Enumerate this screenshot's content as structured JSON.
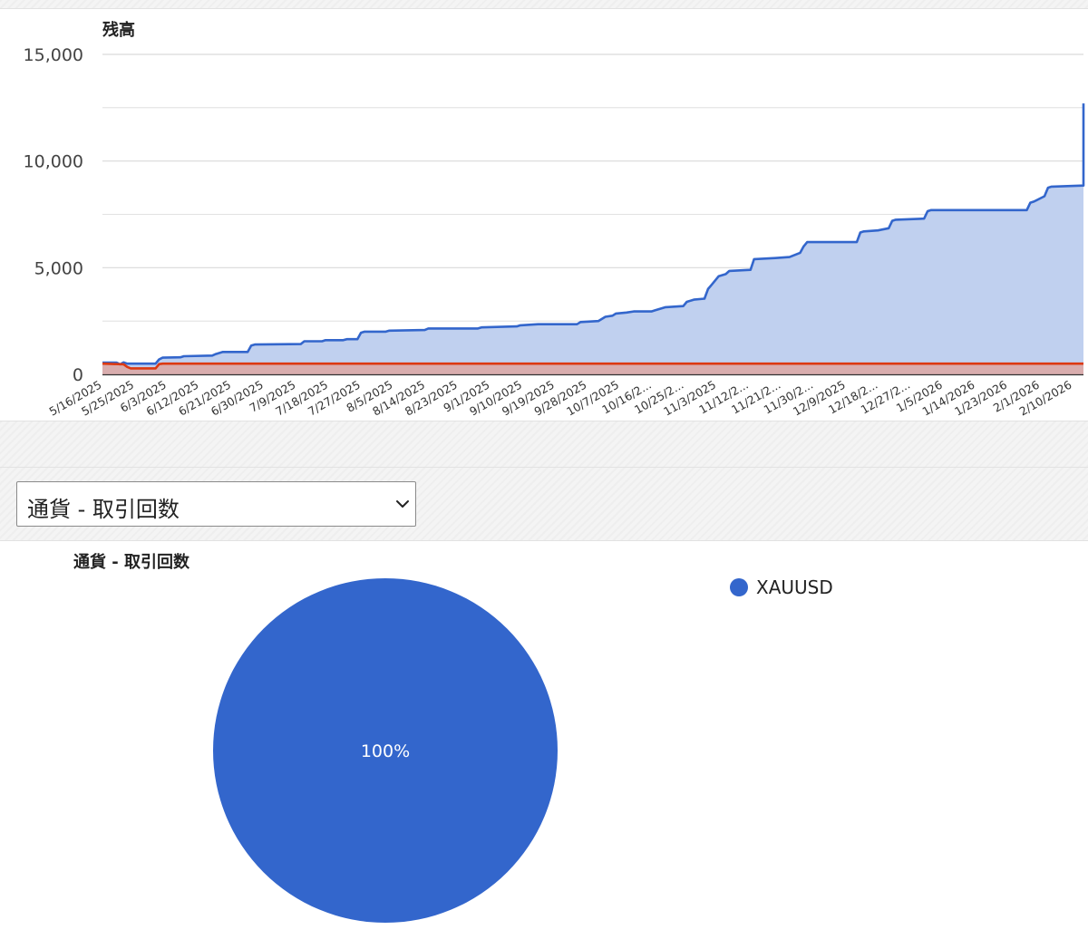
{
  "chart_data": [
    {
      "type": "area",
      "title": "残高",
      "xlabel": "",
      "ylabel": "",
      "ylim": [
        0,
        15000
      ],
      "y_ticks": [
        "0",
        "5,000",
        "10,000",
        "15,000"
      ],
      "y_tick_values": [
        0,
        5000,
        10000,
        15000
      ],
      "grid": true,
      "legend": "none",
      "x_tick_labels": [
        "5/16/2025",
        "5/25/2025",
        "6/3/2025",
        "6/12/2025",
        "6/21/2025",
        "6/30/2025",
        "7/9/2025",
        "7/18/2025",
        "7/27/2025",
        "8/5/2025",
        "8/14/2025",
        "8/23/2025",
        "9/1/2025",
        "9/10/2025",
        "9/19/2025",
        "9/28/2025",
        "10/7/2025",
        "10/16/2...",
        "10/25/2...",
        "11/3/2025",
        "11/12/2...",
        "11/21/2...",
        "11/30/2...",
        "12/9/2025",
        "12/18/2...",
        "12/27/2...",
        "1/5/2026",
        "1/14/2026",
        "1/23/2026",
        "2/1/2026",
        "2/10/2026"
      ],
      "x_range": [
        "2025-05-14",
        "2026-02-15"
      ],
      "series": [
        {
          "color": "#3366cc",
          "fill": "#c0d0ef",
          "points": [
            [
              "2025-05-14",
              550
            ],
            [
              "2025-05-18",
              550
            ],
            [
              "2025-05-19",
              470
            ],
            [
              "2025-05-20",
              560
            ],
            [
              "2025-05-21",
              500
            ],
            [
              "2025-05-29",
              500
            ],
            [
              "2025-05-30",
              700
            ],
            [
              "2025-05-31",
              780
            ],
            [
              "2025-06-05",
              800
            ],
            [
              "2025-06-06",
              850
            ],
            [
              "2025-06-14",
              880
            ],
            [
              "2025-06-15",
              950
            ],
            [
              "2025-06-17",
              1050
            ],
            [
              "2025-06-24",
              1050
            ],
            [
              "2025-06-25",
              1350
            ],
            [
              "2025-06-26",
              1400
            ],
            [
              "2025-07-09",
              1420
            ],
            [
              "2025-07-10",
              1550
            ],
            [
              "2025-07-15",
              1550
            ],
            [
              "2025-07-16",
              1600
            ],
            [
              "2025-07-21",
              1600
            ],
            [
              "2025-07-22",
              1650
            ],
            [
              "2025-07-25",
              1650
            ],
            [
              "2025-07-26",
              1950
            ],
            [
              "2025-07-27",
              2000
            ],
            [
              "2025-08-02",
              2000
            ],
            [
              "2025-08-03",
              2050
            ],
            [
              "2025-08-13",
              2080
            ],
            [
              "2025-08-14",
              2150
            ],
            [
              "2025-08-28",
              2150
            ],
            [
              "2025-08-29",
              2200
            ],
            [
              "2025-09-08",
              2250
            ],
            [
              "2025-09-09",
              2300
            ],
            [
              "2025-09-14",
              2350
            ],
            [
              "2025-09-25",
              2350
            ],
            [
              "2025-09-26",
              2450
            ],
            [
              "2025-10-01",
              2500
            ],
            [
              "2025-10-03",
              2700
            ],
            [
              "2025-10-05",
              2750
            ],
            [
              "2025-10-06",
              2850
            ],
            [
              "2025-10-09",
              2900
            ],
            [
              "2025-10-11",
              2950
            ],
            [
              "2025-10-16",
              2950
            ],
            [
              "2025-10-17",
              3000
            ],
            [
              "2025-10-20",
              3150
            ],
            [
              "2025-10-25",
              3200
            ],
            [
              "2025-10-26",
              3400
            ],
            [
              "2025-10-28",
              3500
            ],
            [
              "2025-10-31",
              3550
            ],
            [
              "2025-11-01",
              4000
            ],
            [
              "2025-11-02",
              4200
            ],
            [
              "2025-11-04",
              4600
            ],
            [
              "2025-11-06",
              4700
            ],
            [
              "2025-11-07",
              4850
            ],
            [
              "2025-11-13",
              4900
            ],
            [
              "2025-11-14",
              5400
            ],
            [
              "2025-11-20",
              5450
            ],
            [
              "2025-11-24",
              5500
            ],
            [
              "2025-11-27",
              5700
            ],
            [
              "2025-11-28",
              6000
            ],
            [
              "2025-11-29",
              6200
            ],
            [
              "2025-12-13",
              6200
            ],
            [
              "2025-12-14",
              6650
            ],
            [
              "2025-12-15",
              6700
            ],
            [
              "2025-12-19",
              6750
            ],
            [
              "2025-12-22",
              6850
            ],
            [
              "2025-12-23",
              7200
            ],
            [
              "2025-12-24",
              7250
            ],
            [
              "2026-01-01",
              7300
            ],
            [
              "2026-01-02",
              7650
            ],
            [
              "2026-01-03",
              7700
            ],
            [
              "2026-01-30",
              7700
            ],
            [
              "2026-01-31",
              8050
            ],
            [
              "2026-02-01",
              8100
            ],
            [
              "2026-02-04",
              8350
            ],
            [
              "2026-02-05",
              8750
            ],
            [
              "2026-02-06",
              8800
            ],
            [
              "2026-02-15",
              8850
            ],
            [
              "2026-02-16",
              9250
            ],
            [
              "2026-02-17",
              9800
            ],
            [
              "2026-02-18",
              10100
            ],
            [
              "2026-02-19",
              10500
            ],
            [
              "2026-02-20",
              11000
            ],
            [
              "2026-02-21",
              11800
            ],
            [
              "2026-02-22",
              12300
            ],
            [
              "2026-02-24",
              12650
            ],
            [
              "2026-03-01",
              12700
            ]
          ]
        },
        {
          "color": "#dc3912",
          "fill": "#dba8a6",
          "points": [
            [
              "2025-05-14",
              500
            ],
            [
              "2025-05-20",
              470
            ],
            [
              "2025-05-21",
              350
            ],
            [
              "2025-05-22",
              280
            ],
            [
              "2025-05-29",
              280
            ],
            [
              "2025-05-30",
              480
            ],
            [
              "2025-05-31",
              500
            ],
            [
              "2026-03-01",
              500
            ]
          ]
        }
      ]
    },
    {
      "type": "pie",
      "title": "通貨 - 取引回数",
      "categories": [
        "XAUUSD"
      ],
      "values": [
        100
      ],
      "slice_labels": [
        "100%"
      ],
      "colors": [
        "#3366cc"
      ],
      "legend": "right"
    }
  ],
  "select": {
    "value": "通貨 - 取引回数",
    "icon": "chevron-down-icon"
  }
}
